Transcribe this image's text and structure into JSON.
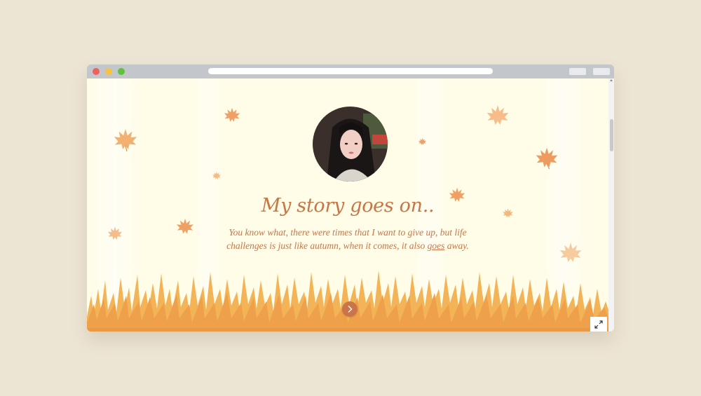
{
  "browser": {
    "window_controls": [
      "close",
      "minimize",
      "maximize"
    ]
  },
  "page": {
    "headline": "My story goes on..",
    "body_line1": "You know what, there were times that I want to give up, but life",
    "body_line2_before_link": "challenges is just like autumn, when it comes, it also ",
    "body_link": "goes",
    "body_line2_after_link": " away."
  },
  "icons": {
    "next": "chevron-right-icon",
    "expand": "expand-icon",
    "leaf": "maple-leaf-icon"
  },
  "colors": {
    "page_background": "#ede5d4",
    "content_background": "#fffce7",
    "accent_text": "#c67747",
    "grass": "#f0a94a",
    "button": "#c9744a"
  }
}
